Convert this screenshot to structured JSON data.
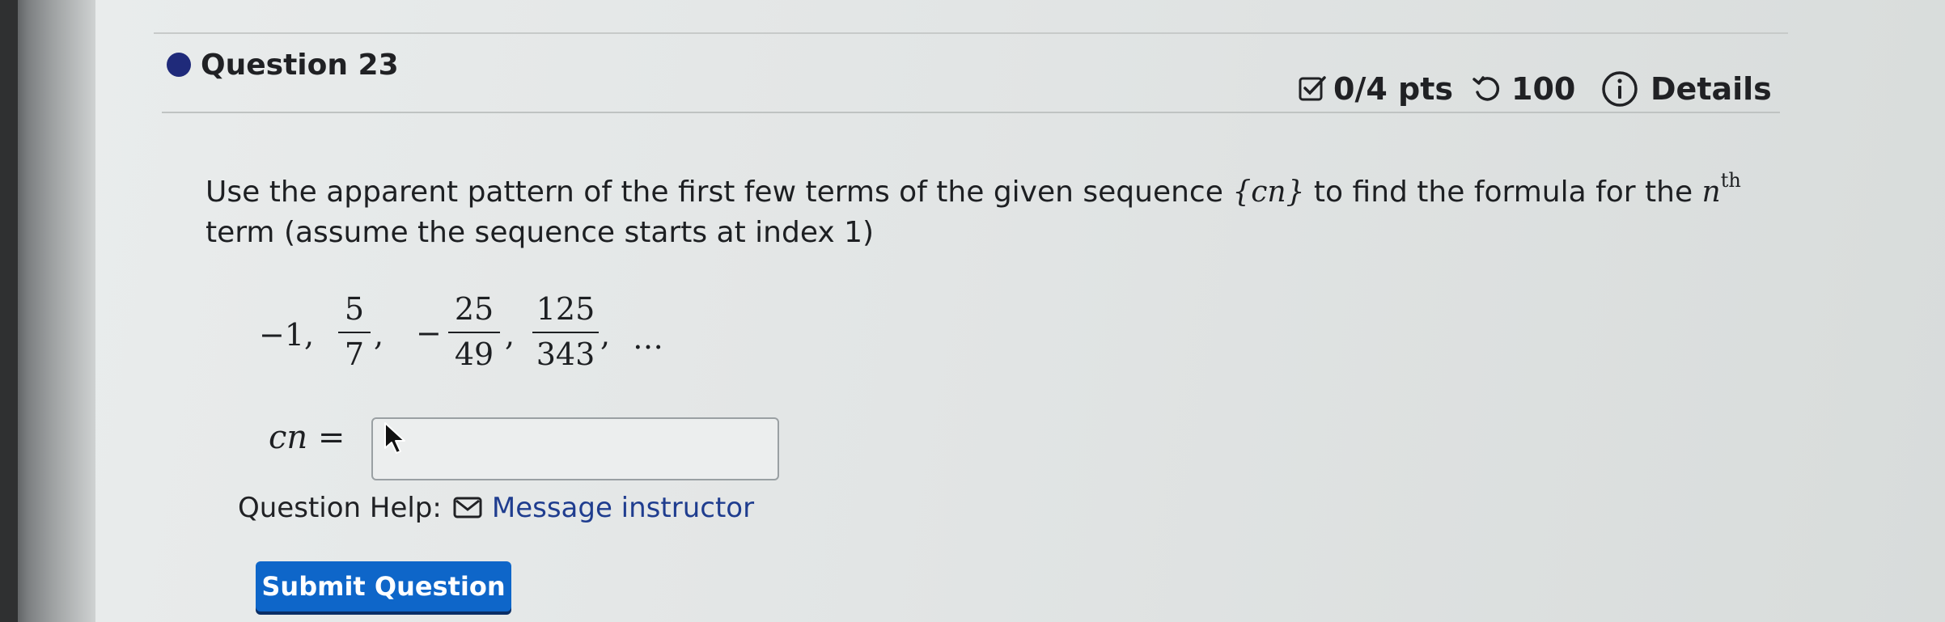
{
  "question": {
    "title": "Question 23",
    "points": "0/4 pts",
    "attempts": "100",
    "details_label": "Details"
  },
  "prompt": {
    "text_1": "Use the apparent pattern of the first few terms of the given sequence ",
    "seq_symbol": "{cn}",
    "text_2": " to find the formula for the ",
    "nth_n": "n",
    "nth_sup": "th",
    "text_3": "term (assume the sequence starts at index 1)"
  },
  "sequence": {
    "t1": "−1,",
    "t2_num": "5",
    "t2_den": "7",
    "sep2": ",",
    "t3_sign": "−",
    "t3_num": "25",
    "t3_den": "49",
    "sep3": ",",
    "t4_num": "125",
    "t4_den": "343",
    "sep4": ",",
    "ellipsis": "…"
  },
  "answer": {
    "label": "cn =",
    "value": ""
  },
  "help": {
    "label": "Question Help:",
    "message_link": "Message instructor"
  },
  "submit_label": "Submit Question",
  "icons": [
    "checkbox-icon",
    "retry-icon",
    "info-icon",
    "envelope-icon",
    "cursor-icon"
  ]
}
